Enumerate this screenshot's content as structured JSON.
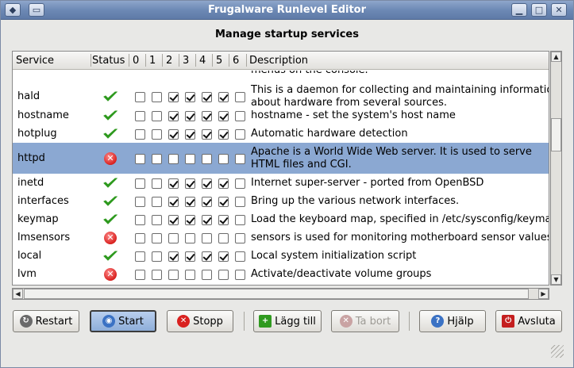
{
  "window": {
    "title": "Frugalware Runlevel Editor"
  },
  "heading": "Manage startup services",
  "columns": {
    "service": "Service",
    "status": "Status",
    "levels": [
      "0",
      "1",
      "2",
      "3",
      "4",
      "5",
      "6"
    ],
    "description": "Description"
  },
  "partial_row_text": "menus on the console.",
  "rows": [
    {
      "name": "hald",
      "status": "running",
      "levels": [
        false,
        false,
        true,
        true,
        true,
        true,
        false
      ],
      "desc1": "This is a daemon for collecting and maintaining information",
      "desc2": "about hardware from several sources."
    },
    {
      "name": "hostname",
      "status": "running",
      "levels": [
        false,
        false,
        true,
        true,
        true,
        true,
        false
      ],
      "desc1": "hostname - set the system's host name",
      "desc2": ""
    },
    {
      "name": "hotplug",
      "status": "running",
      "levels": [
        false,
        false,
        true,
        true,
        true,
        true,
        false
      ],
      "desc1": "Automatic hardware detection",
      "desc2": ""
    },
    {
      "name": "httpd",
      "status": "stopped",
      "levels": [
        false,
        false,
        false,
        false,
        false,
        false,
        false
      ],
      "desc1": "Apache is a World Wide Web server.  It is used to serve",
      "desc2": "HTML files and CGI.",
      "selected": true
    },
    {
      "name": "inetd",
      "status": "running",
      "levels": [
        false,
        false,
        true,
        true,
        true,
        true,
        false
      ],
      "desc1": "Internet super-server - ported from OpenBSD",
      "desc2": ""
    },
    {
      "name": "interfaces",
      "status": "running",
      "levels": [
        false,
        false,
        true,
        true,
        true,
        true,
        false
      ],
      "desc1": "Bring up the various network interfaces.",
      "desc2": ""
    },
    {
      "name": "keymap",
      "status": "running",
      "levels": [
        false,
        false,
        true,
        true,
        true,
        true,
        false
      ],
      "desc1": "Load the keyboard map, specified in /etc/sysconfig/keymap",
      "desc2": ""
    },
    {
      "name": "lmsensors",
      "status": "stopped",
      "levels": [
        false,
        false,
        false,
        false,
        false,
        false,
        false
      ],
      "desc1": "sensors is used for monitoring motherboard sensor values.",
      "desc2": ""
    },
    {
      "name": "local",
      "status": "running",
      "levels": [
        false,
        false,
        true,
        true,
        true,
        true,
        false
      ],
      "desc1": "Local system initialization script",
      "desc2": ""
    },
    {
      "name": "lvm",
      "status": "stopped",
      "levels": [
        false,
        false,
        false,
        false,
        false,
        false,
        false
      ],
      "desc1": "Activate/deactivate volume groups",
      "desc2": ""
    }
  ],
  "buttons": {
    "restart": "Restart",
    "start": "Start",
    "stop": "Stopp",
    "add": "Lägg till",
    "remove": "Ta bort",
    "help": "Hjälp",
    "quit": "Avsluta"
  },
  "colors": {
    "selection": "#8ba8d2",
    "ok": "#2f9a1f",
    "error": "#d9211f",
    "titlebar": "#6d89b5"
  }
}
